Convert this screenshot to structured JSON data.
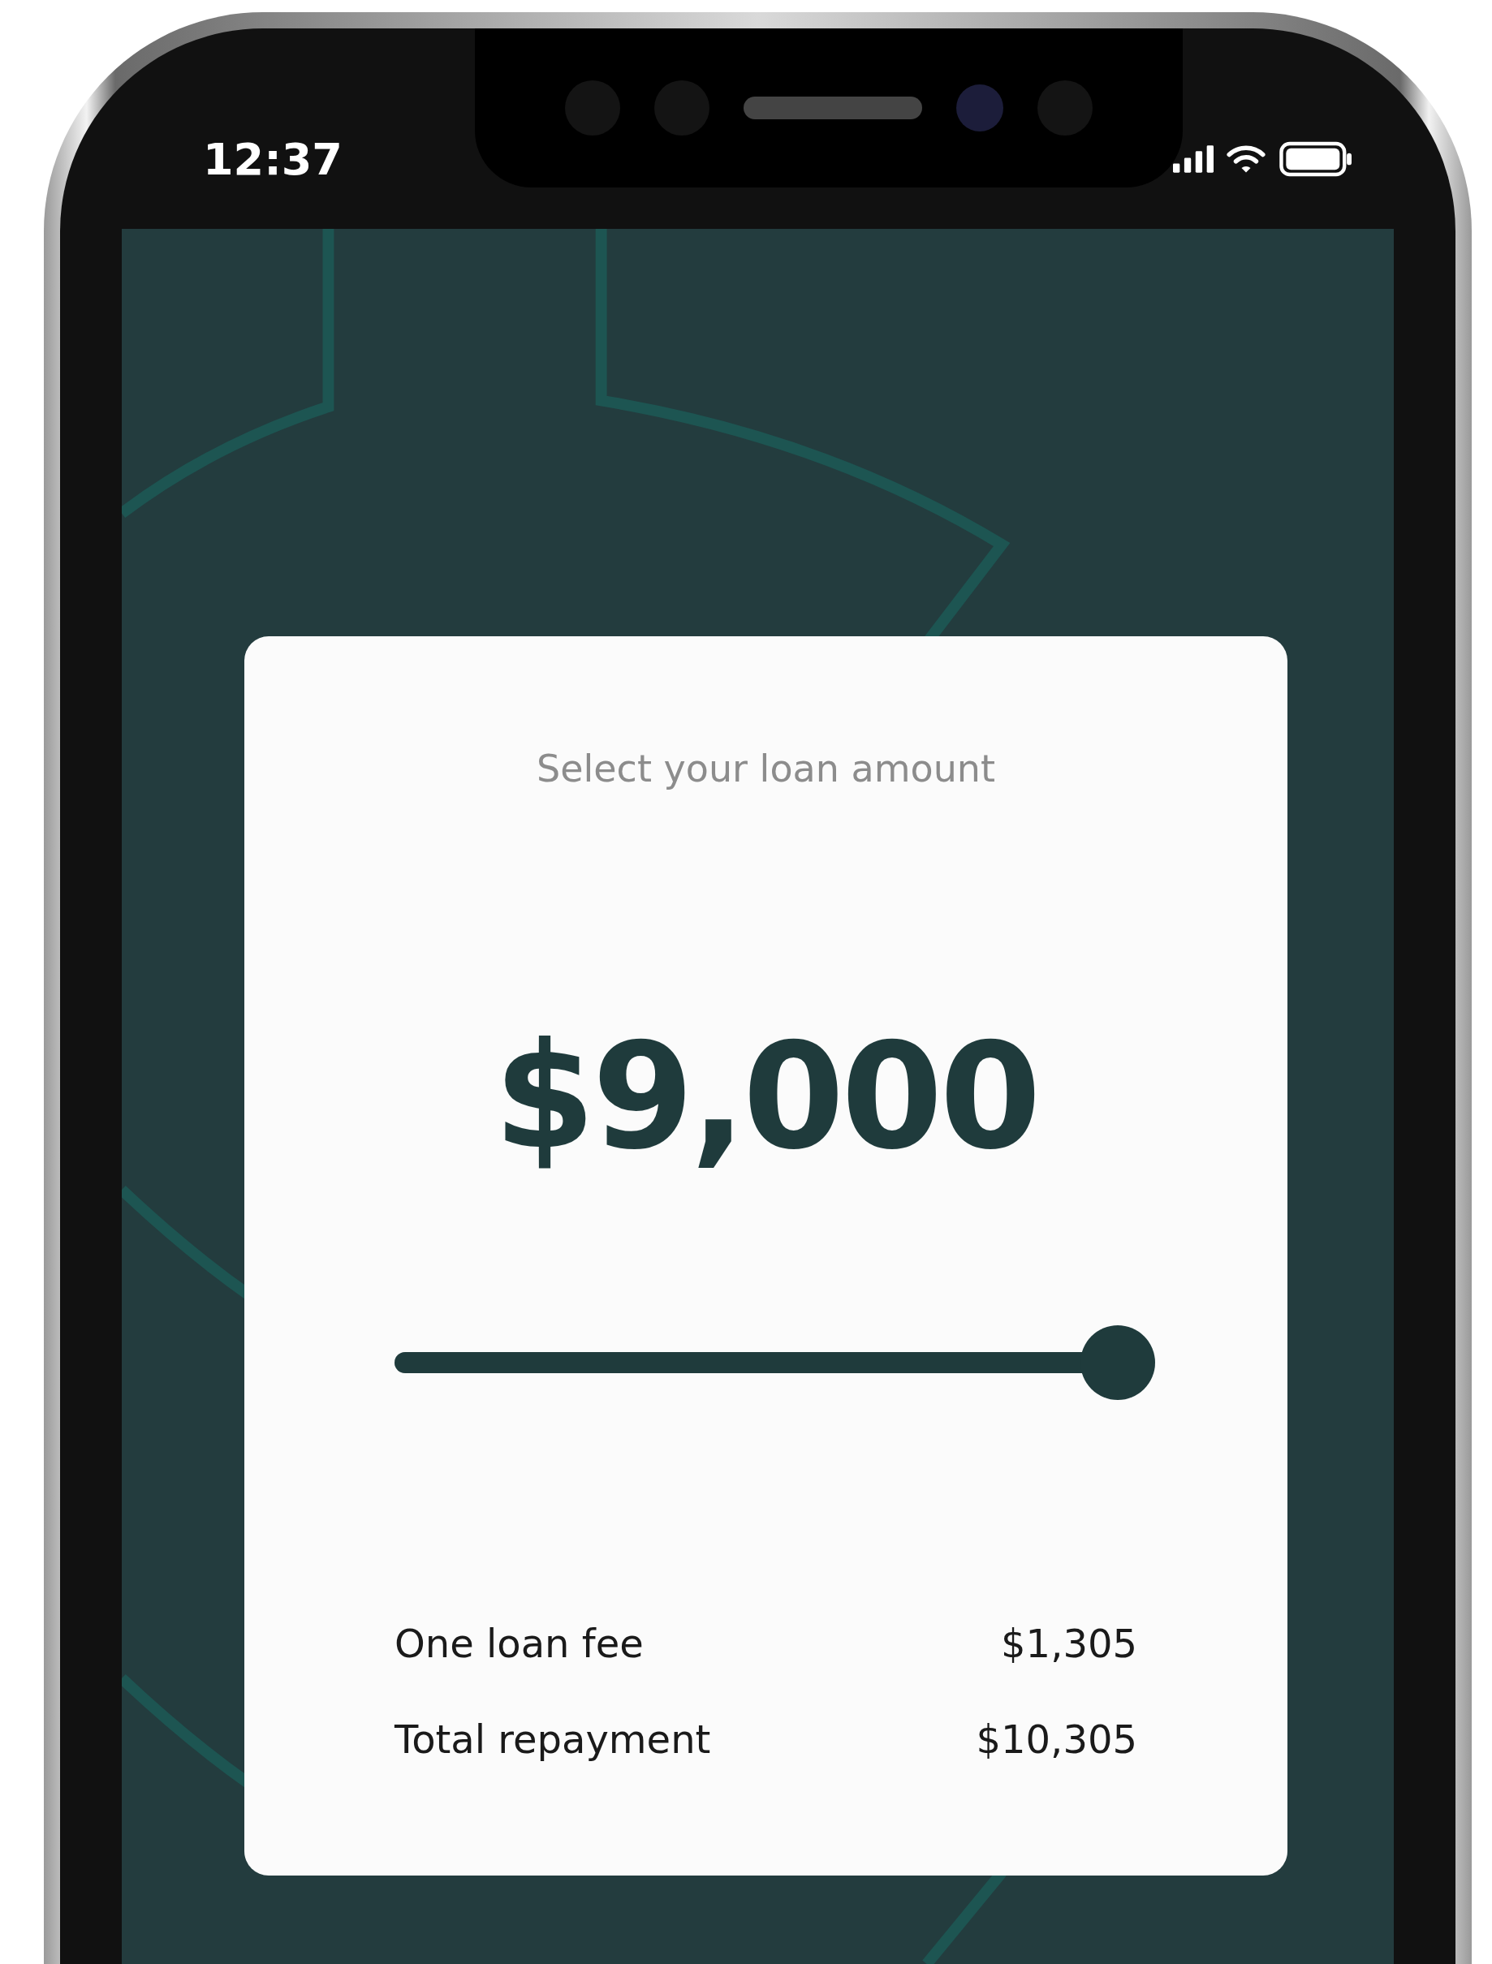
{
  "status_bar": {
    "time": "12:37"
  },
  "loan_card": {
    "title": "Select your loan amount",
    "amount": "$9,000",
    "slider": {
      "level": 1.0
    },
    "rows": [
      {
        "label": "One loan fee",
        "value": "$1,305"
      },
      {
        "label": "Total repayment",
        "value": "$10,305"
      }
    ]
  }
}
